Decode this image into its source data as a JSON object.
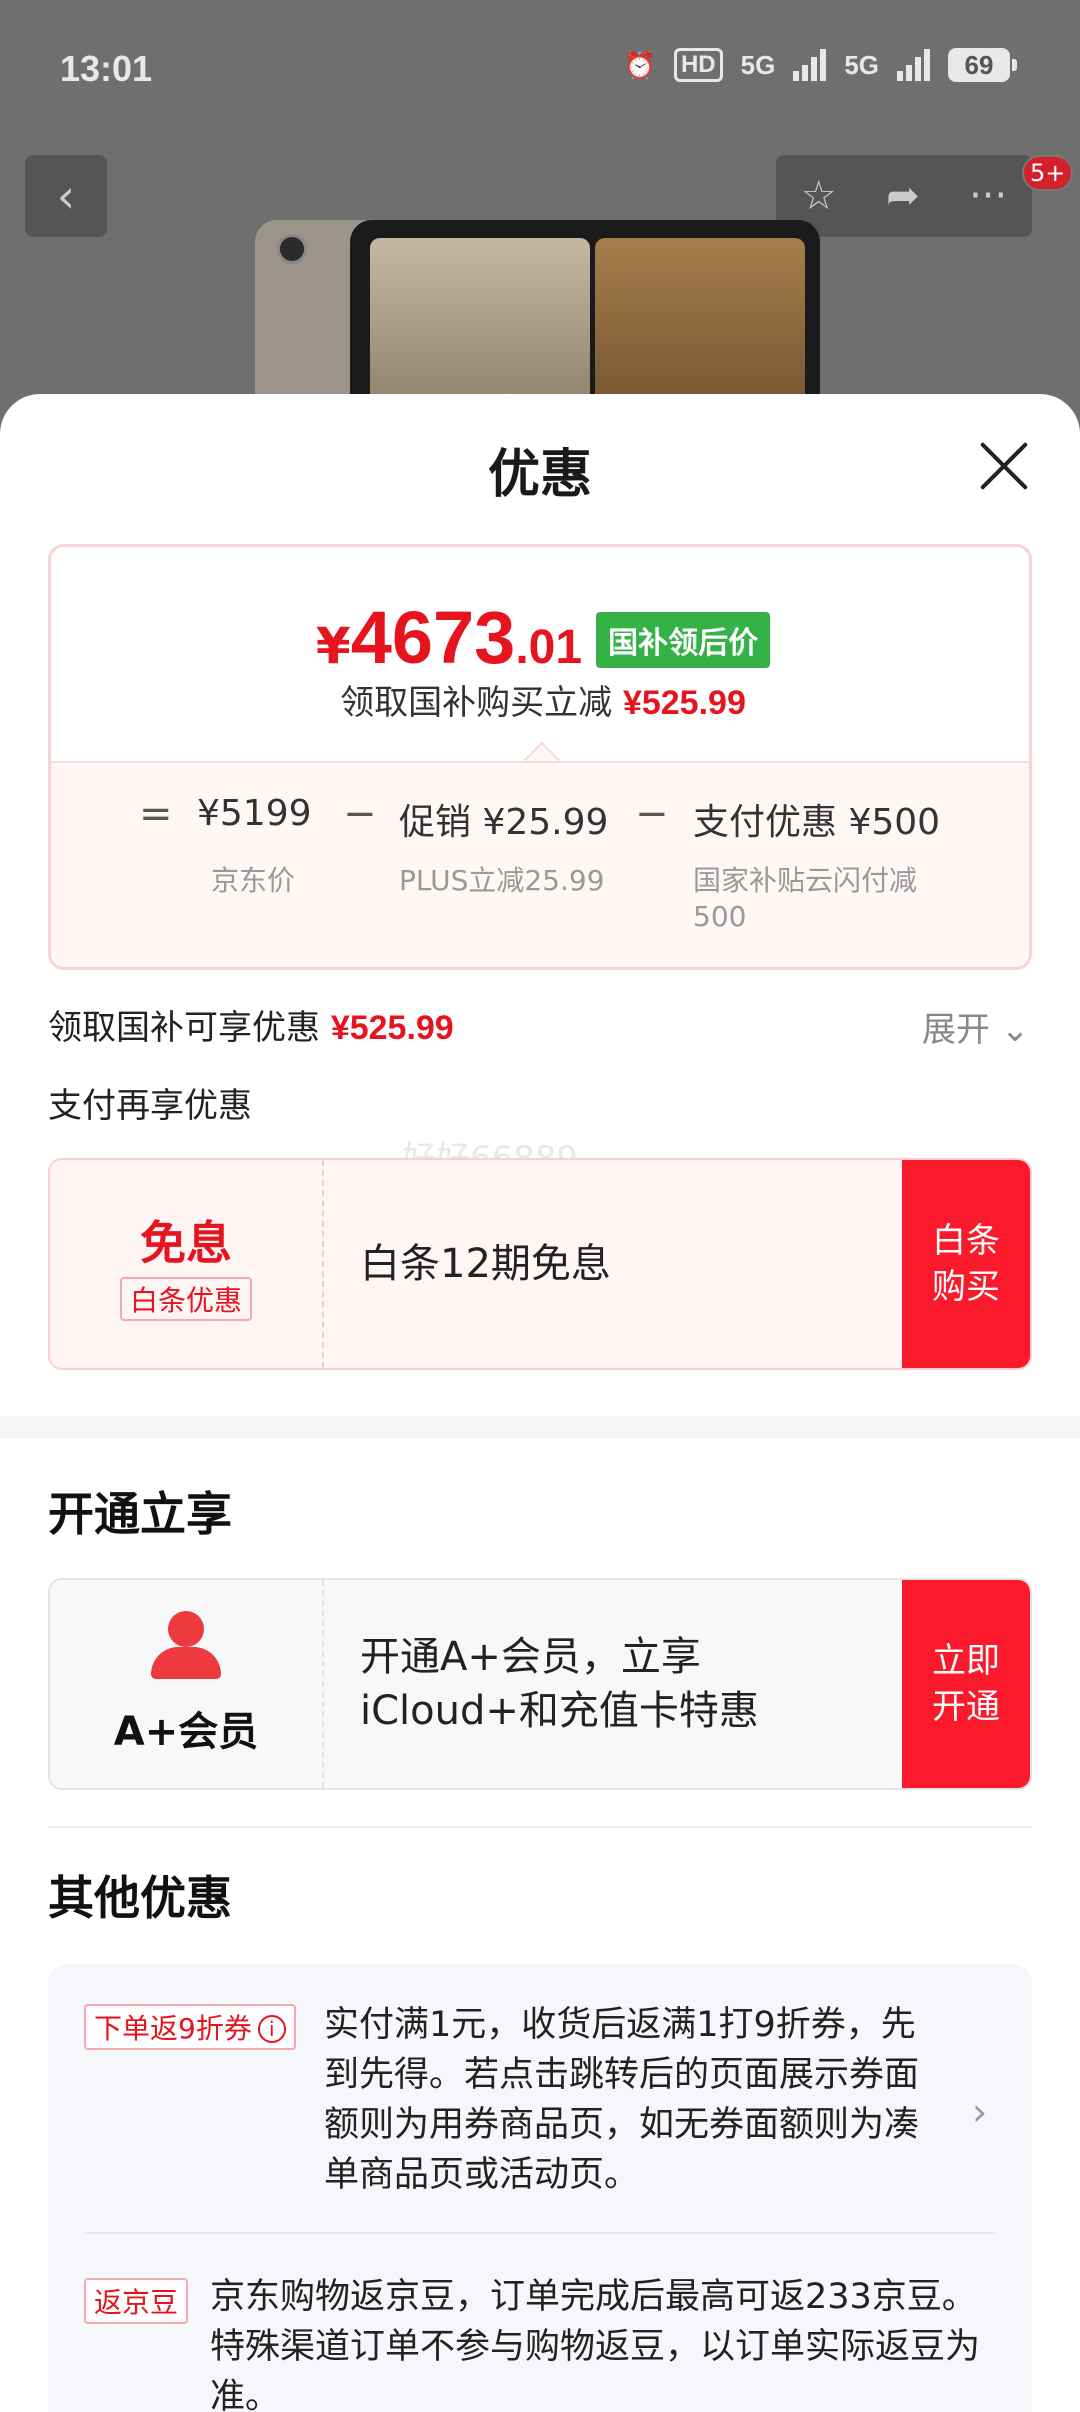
{
  "status_bar": {
    "time": "13:01",
    "hd": "HD",
    "net1": "5G",
    "net2": "5G",
    "battery": "69"
  },
  "background_nav": {
    "back_icon": "chevron-left-icon",
    "actions": [
      "star-icon",
      "share-icon",
      "more-icon"
    ],
    "badge": "5+"
  },
  "sheet": {
    "title": "优惠",
    "close_icon": "close-icon"
  },
  "price_card": {
    "currency": "¥",
    "price_int": "4673",
    "price_dec": ".01",
    "price_tag": "国补领后价",
    "subtitle": "领取国补购买立减",
    "subtitle_amount": "¥525.99",
    "breakdown": {
      "eq": "=",
      "items": [
        {
          "value": "¥5199",
          "note": "京东价"
        },
        {
          "value": "促销 ¥25.99",
          "note": "PLUS立减25.99"
        },
        {
          "value": "支付优惠 ¥500",
          "note": "国家补贴云闪付减500"
        }
      ],
      "minus": "−"
    }
  },
  "gov_subsidy": {
    "label": "领取国补可享优惠",
    "amount": "¥525.99",
    "expand": "展开"
  },
  "pay_more": {
    "label": "支付再享优惠"
  },
  "watermark": "好好66889",
  "baitiao_offer": {
    "title": "免息",
    "tag": "白条优惠",
    "desc": "白条12期免息",
    "button": "白条购买"
  },
  "open_section": {
    "title": "开通立享",
    "member_name": "A+会员",
    "desc_line1": "开通A+会员，立享",
    "desc_line2": "iCloud+和充值卡特惠",
    "button": "立即开通"
  },
  "other_section": {
    "title": "其他优惠",
    "items": [
      {
        "tag": "下单返9折券",
        "text": "实付满1元，收货后返满1打9折券，先到先得。若点击跳转后的页面展示券面额则为用券商品页，如无券面额则为凑单商品页或活动页。"
      },
      {
        "tag": "返京豆",
        "text": "京东购物返京豆，订单完成后最高可返233京豆。特殊渠道订单不参与购物返豆，以订单实际返豆为准。"
      }
    ]
  }
}
